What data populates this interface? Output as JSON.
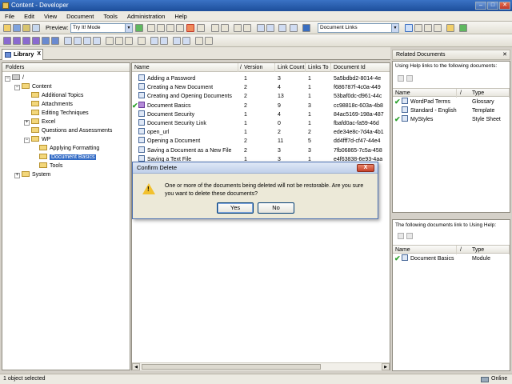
{
  "window": {
    "title": "Content - Developer",
    "minimize": "–",
    "maximize": "□",
    "close": "✕"
  },
  "menu": [
    "File",
    "Edit",
    "View",
    "Document",
    "Tools",
    "Administration",
    "Help"
  ],
  "toolbar": {
    "preview_label": "Preview:",
    "preview_mode": "Try It! Mode",
    "links_filter": "Document Links"
  },
  "tab": {
    "label": "Library",
    "close": "X"
  },
  "folders": {
    "header": "Folders",
    "items": [
      {
        "label": "/",
        "expander": "−"
      },
      {
        "label": "Content",
        "expander": "−"
      },
      {
        "label": "Additional Topics",
        "expander": ""
      },
      {
        "label": "Attachments",
        "expander": ""
      },
      {
        "label": "Editing Techniques",
        "expander": ""
      },
      {
        "label": "Excel",
        "expander": "+"
      },
      {
        "label": "Questions and Assessments",
        "expander": ""
      },
      {
        "label": "WP",
        "expander": "−"
      },
      {
        "label": "Applying Formatting",
        "expander": ""
      },
      {
        "label": "Document Basics",
        "expander": ""
      },
      {
        "label": "Tools",
        "expander": ""
      },
      {
        "label": "System",
        "expander": "+"
      }
    ]
  },
  "docs": {
    "columns": [
      "Name",
      "/",
      "Version",
      "Link Count",
      "Links To",
      "Document Id"
    ],
    "rows": [
      {
        "name": "Adding a Password",
        "version": "1",
        "link_count": "3",
        "links_to": "1",
        "doc_id": "5a5bdbd2-8014-4e",
        "checked": false
      },
      {
        "name": "Creating a New Document",
        "version": "2",
        "link_count": "4",
        "links_to": "1",
        "doc_id": "f686787f-4c0a-449",
        "checked": false
      },
      {
        "name": "Creating and Opening Documents",
        "version": "2",
        "link_count": "13",
        "links_to": "1",
        "doc_id": "53baf0dc-d961-44c",
        "checked": false
      },
      {
        "name": "Document Basics",
        "version": "2",
        "link_count": "9",
        "links_to": "3",
        "doc_id": "cc98818c-603a-4b8",
        "checked": true
      },
      {
        "name": "Document Security",
        "version": "1",
        "link_count": "4",
        "links_to": "1",
        "doc_id": "84ac5169-198a-487",
        "checked": false
      },
      {
        "name": "Document Security Link",
        "version": "1",
        "link_count": "0",
        "links_to": "1",
        "doc_id": "fbafd0ac-fa59-46d",
        "checked": false
      },
      {
        "name": "open_url",
        "version": "1",
        "link_count": "2",
        "links_to": "2",
        "doc_id": "ede34e8c-7d4a-4b1",
        "checked": false
      },
      {
        "name": "Opening a Document",
        "version": "2",
        "link_count": "11",
        "links_to": "5",
        "doc_id": "dd4fff7d-cf47-44e4",
        "checked": false
      },
      {
        "name": "Saving a Document as a New File",
        "version": "2",
        "link_count": "3",
        "links_to": "3",
        "doc_id": "7fb06865-7c5a-458",
        "checked": false
      },
      {
        "name": "Saving a Text File",
        "version": "1",
        "link_count": "3",
        "links_to": "1",
        "doc_id": "e4f63838-6e93-4aa",
        "checked": false
      }
    ]
  },
  "related": {
    "header": "Related Documents",
    "close": "✕",
    "help_links_label": "Using Help links to the following documents:",
    "columns": [
      "Name",
      "/",
      "Type"
    ],
    "items": [
      {
        "name": "WordPad Terms",
        "type": "Glossary",
        "checked": true
      },
      {
        "name": "Standard - English",
        "type": "Template",
        "checked": false
      },
      {
        "name": "MyStyles",
        "type": "Style Sheet",
        "checked": true
      }
    ],
    "link_in_label": "The following documents link to Using Help:",
    "link_in_items": [
      {
        "name": "Document Basics",
        "type": "Module",
        "checked": true
      }
    ]
  },
  "dialog": {
    "title": "Confirm Delete",
    "close": "X",
    "message": "One or more of the documents being deleted will not be restorable. Are you sure you want to delete these documents?",
    "warning_mark": "!",
    "yes": "Yes",
    "no": "No"
  },
  "status": {
    "selection": "1 object selected",
    "connection": "Online"
  }
}
